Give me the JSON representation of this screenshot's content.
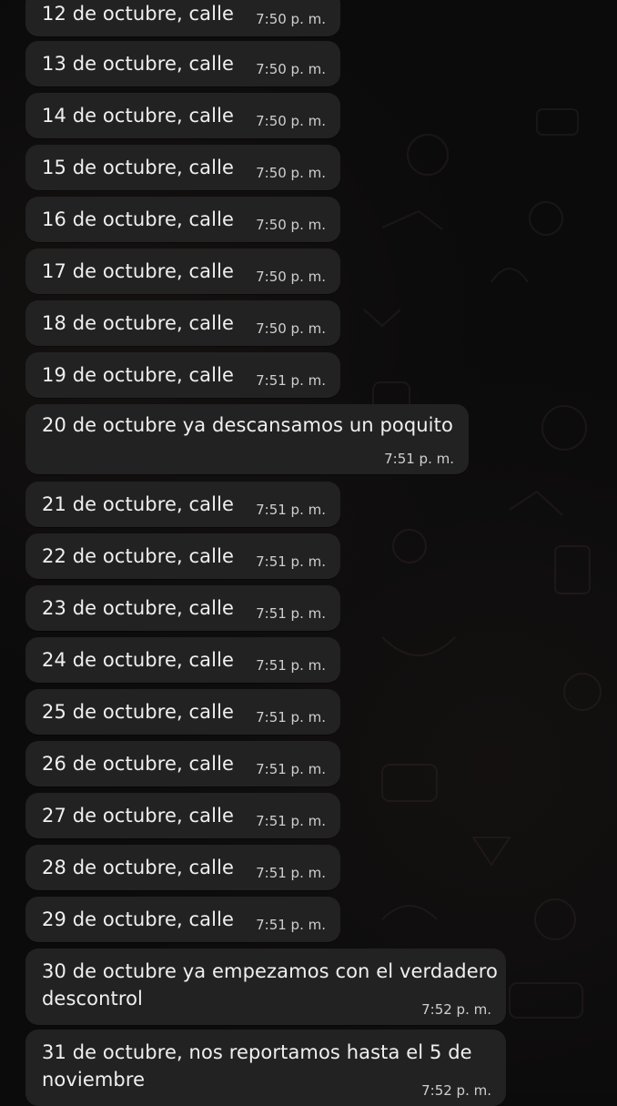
{
  "messages": [
    {
      "text": "12 de octubre, calle",
      "time": "7:50 p. m."
    },
    {
      "text": "13 de octubre, calle",
      "time": "7:50 p. m."
    },
    {
      "text": "14 de octubre, calle",
      "time": "7:50 p. m."
    },
    {
      "text": "15 de octubre, calle",
      "time": "7:50 p. m."
    },
    {
      "text": "16 de octubre, calle",
      "time": "7:50 p. m."
    },
    {
      "text": "17 de octubre, calle",
      "time": "7:50 p. m."
    },
    {
      "text": "18 de octubre, calle",
      "time": "7:50 p. m."
    },
    {
      "text": "19 de octubre, calle",
      "time": "7:51 p. m."
    },
    {
      "text": "20 de octubre ya descansamos un poquito",
      "time": "7:51 p. m."
    },
    {
      "text": "21 de octubre, calle",
      "time": "7:51 p. m."
    },
    {
      "text": "22 de octubre, calle",
      "time": "7:51 p. m."
    },
    {
      "text": "23 de octubre, calle",
      "time": "7:51 p. m."
    },
    {
      "text": "24 de octubre, calle",
      "time": "7:51 p. m."
    },
    {
      "text": "25 de octubre, calle",
      "time": "7:51 p. m."
    },
    {
      "text": "26 de octubre, calle",
      "time": "7:51 p. m."
    },
    {
      "text": "27 de octubre, calle",
      "time": "7:51 p. m."
    },
    {
      "text": "28 de octubre, calle",
      "time": "7:51 p. m."
    },
    {
      "text": "29 de octubre, calle",
      "time": "7:51 p. m."
    },
    {
      "text": "30 de octubre ya empezamos con el verdadero descontrol",
      "time": "7:52 p. m."
    },
    {
      "text": "31 de octubre, nos reportamos hasta el 5 de noviembre",
      "time": "7:52 p. m."
    }
  ]
}
